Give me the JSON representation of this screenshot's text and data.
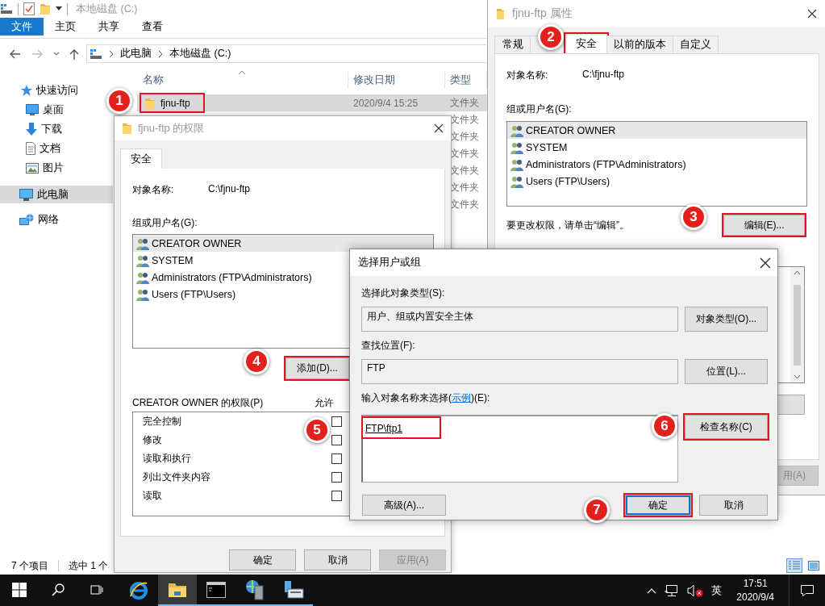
{
  "explorer": {
    "title": "本地磁盘 (C:)",
    "ribbon_tabs": [
      {
        "label": "文件",
        "selected": true
      },
      {
        "label": "主页",
        "selected": false
      },
      {
        "label": "共享",
        "selected": false
      },
      {
        "label": "查看",
        "selected": false
      }
    ],
    "breadcrumb": [
      "此电脑",
      "本地磁盘 (C:)"
    ],
    "nav": [
      {
        "label": "快速访问",
        "kind": "star",
        "selected": false,
        "children": [
          {
            "label": "桌面",
            "kind": "desktop",
            "selected": false
          },
          {
            "label": "下载",
            "kind": "download",
            "selected": false
          },
          {
            "label": "文档",
            "kind": "document",
            "selected": false
          },
          {
            "label": "图片",
            "kind": "picture",
            "selected": false
          }
        ]
      },
      {
        "label": "此电脑",
        "kind": "computer",
        "selected": true
      },
      {
        "label": "网络",
        "kind": "network",
        "selected": false
      }
    ],
    "columns": [
      "名称",
      "修改日期",
      "类型"
    ],
    "rows": [
      {
        "name": "fjnu-ftp",
        "date": "2020/9/4 15:25",
        "type": "文件夹",
        "selected": true,
        "highlighted": true
      },
      {
        "type": "文件夹",
        "selected": false
      },
      {
        "type": "文件夹",
        "selected": false
      },
      {
        "type": "文件夹",
        "selected": false
      },
      {
        "type": "文件夹",
        "selected": false
      },
      {
        "type": "文件夹",
        "selected": false
      },
      {
        "type": "文件夹",
        "selected": false
      }
    ],
    "status": [
      "7 个项目",
      "选中 1 个"
    ],
    "view_buttons": [
      {
        "kind": "details",
        "selected": true
      },
      {
        "kind": "preview",
        "selected": false
      }
    ]
  },
  "properties": {
    "title": "fjnu-ftp 属性",
    "tabs": [
      {
        "label": "常规",
        "selected": false,
        "highlighted": false
      },
      {
        "selected": false,
        "highlighted": false
      },
      {
        "label": "安全",
        "selected": true,
        "highlighted": true
      },
      {
        "label": "以前的版本",
        "selected": false,
        "highlighted": false
      },
      {
        "label": "自定义",
        "selected": false,
        "highlighted": false
      }
    ],
    "object_label": "对象名称:",
    "object_value": "C:\\fjnu-ftp",
    "users_label": "组或用户名(G):",
    "users": [
      {
        "name": "CREATOR OWNER",
        "selected": true
      },
      {
        "name": "SYSTEM",
        "selected": false
      },
      {
        "name": "Administrators (FTP\\Administrators)",
        "selected": false
      },
      {
        "name": "Users (FTP\\Users)",
        "selected": false
      }
    ],
    "hint": "要更改权限，请单击“编辑”。",
    "edit_button": {
      "label": "编辑(E)...",
      "highlighted": true
    },
    "apply_button": {
      "label": "用(A)",
      "disabled": true
    }
  },
  "permissions": {
    "title": "fjnu-ftp 的权限",
    "tabs": [
      {
        "label": "安全",
        "selected": true
      }
    ],
    "object_label": "对象名称:",
    "object_value": "C:\\fjnu-ftp",
    "users_label": "组或用户名(G):",
    "users": [
      {
        "name": "CREATOR OWNER",
        "selected": true
      },
      {
        "name": "SYSTEM",
        "selected": false
      },
      {
        "name": "Administrators (FTP\\Administrators)",
        "selected": false
      },
      {
        "name": "Users (FTP\\Users)",
        "selected": false
      }
    ],
    "add_button": {
      "label": "添加(D)...",
      "highlighted": true
    },
    "perm_label": "CREATOR OWNER 的权限(P)",
    "allow_label": "允许",
    "perms": [
      {
        "name": "完全控制",
        "allow": false
      },
      {
        "name": "修改",
        "allow": false
      },
      {
        "name": "读取和执行",
        "allow": false
      },
      {
        "name": "列出文件夹内容",
        "allow": false
      },
      {
        "name": "读取",
        "allow": false
      }
    ],
    "buttons": [
      {
        "label": "确定",
        "disabled": false
      },
      {
        "label": "取消",
        "disabled": false
      },
      {
        "label": "应用(A)",
        "disabled": true
      }
    ]
  },
  "select_dialog": {
    "title": "选择用户或组",
    "type_label": "选择此对象类型(S):",
    "type_value": "用户、组或内置安全主体",
    "type_button": {
      "label": "对象类型(O)...",
      "highlighted": false
    },
    "location_label": "查找位置(F):",
    "location_value": "FTP",
    "location_button": {
      "label": "位置(L)...",
      "highlighted": false
    },
    "names_label_before": "输入对象名称来选择(",
    "names_link": "示例",
    "names_label_after": ")(E):",
    "names_value": {
      "text": "FTP\\ftp1",
      "highlighted": true
    },
    "check_button": {
      "label": "检查名称(C)",
      "highlighted": true
    },
    "advanced_button": {
      "label": "高级(A)...",
      "highlighted": false
    },
    "ok_button": {
      "label": "确定",
      "highlighted": true
    },
    "cancel_button": {
      "label": "取消",
      "highlighted": false
    }
  },
  "callouts": [
    "1",
    "2",
    "3",
    "4",
    "5",
    "6",
    "7"
  ],
  "taskbar": {
    "apps": [
      {
        "kind": "browser",
        "open": false,
        "active": false
      },
      {
        "kind": "folder",
        "open": true,
        "active": true
      },
      {
        "kind": "terminal",
        "open": true,
        "active": false
      },
      {
        "kind": "server",
        "open": true,
        "active": false
      },
      {
        "kind": "computer",
        "open": true,
        "active": false
      }
    ],
    "ime": "英",
    "time": "17:51",
    "date": "2020/9/4"
  }
}
